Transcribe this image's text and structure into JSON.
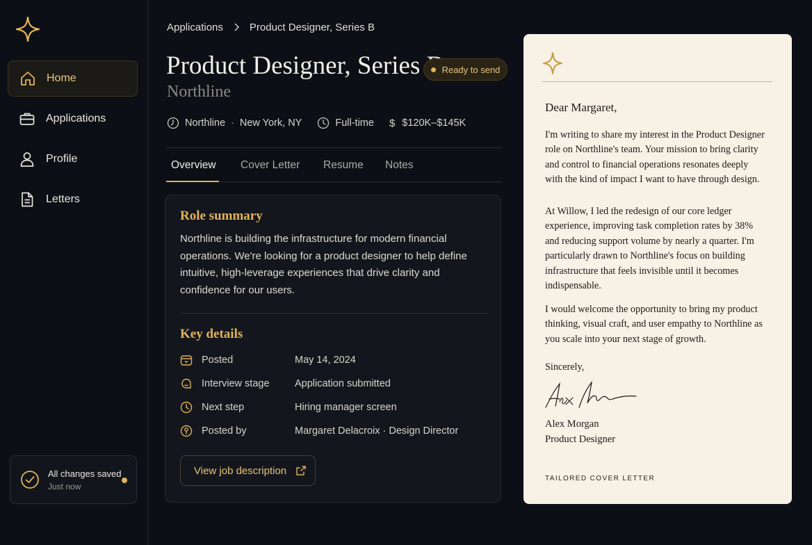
{
  "sidebar": {
    "items": [
      {
        "label": "Home",
        "icon": "home-icon",
        "active": true
      },
      {
        "label": "Applications",
        "icon": "briefcase-icon"
      },
      {
        "label": "Profile",
        "icon": "user-icon"
      },
      {
        "label": "Letters",
        "icon": "document-icon"
      }
    ],
    "save_status": {
      "title": "All changes saved",
      "subtitle": "Just now"
    }
  },
  "breadcrumb": {
    "parent": "Applications",
    "current": "Product Designer, Series B"
  },
  "header": {
    "title": "Product Designer, Series B",
    "badge": "Ready to send",
    "company": "Northline",
    "meta": {
      "company": "Northline",
      "location": "New York, NY",
      "employment": "Full-time",
      "currency_symbol": "$",
      "salary": "$120K–$145K"
    }
  },
  "tabs": [
    {
      "label": "Overview",
      "active": true
    },
    {
      "label": "Cover Letter"
    },
    {
      "label": "Resume"
    },
    {
      "label": "Notes"
    }
  ],
  "overview": {
    "summary_title": "Role summary",
    "summary": "Northline is building the infrastructure for modern financial operations. We're looking for a product designer to help define intuitive, high-leverage experiences that drive clarity and confidence for our users.",
    "details_title": "Key details",
    "details": [
      {
        "key": "Posted",
        "value": "May 14, 2024",
        "icon": "calendar-icon"
      },
      {
        "key": "Interview stage",
        "value": "Application submitted",
        "icon": "chat-icon"
      },
      {
        "key": "Next step",
        "value": "Hiring manager screen",
        "icon": "clock-icon"
      },
      {
        "key": "Posted by",
        "value": "Margaret Delacroix · Design Director",
        "icon": "person-pin-icon"
      }
    ],
    "view_button": "View job description"
  },
  "letter": {
    "greeting": "Dear Margaret,",
    "paragraphs": [
      "I'm writing to share my interest in the Product Designer role on Northline's team. Your mission to bring clarity and control to financial operations resonates deeply with the kind of impact I want to have through design.",
      "At Willow, I led the redesign of our core ledger experience, improving task completion rates by 38% and reducing support volume by nearly a quarter. I'm particularly drawn to Northline's focus on building infrastructure that feels invisible until it becomes indispensable.",
      "I would welcome the opportunity to bring my product thinking, visual craft, and user empathy to Northline as you scale into your next stage of growth."
    ],
    "closing": "Sincerely,",
    "signature_text": "Alex Morgan",
    "name": "Alex Morgan",
    "role": "Product Designer",
    "tag": "TAILORED COVER LETTER"
  },
  "colors": {
    "background": "#0c0f15",
    "accent": "#e2b35a",
    "panel": "#13161c",
    "paper": "#f7f1e6"
  }
}
